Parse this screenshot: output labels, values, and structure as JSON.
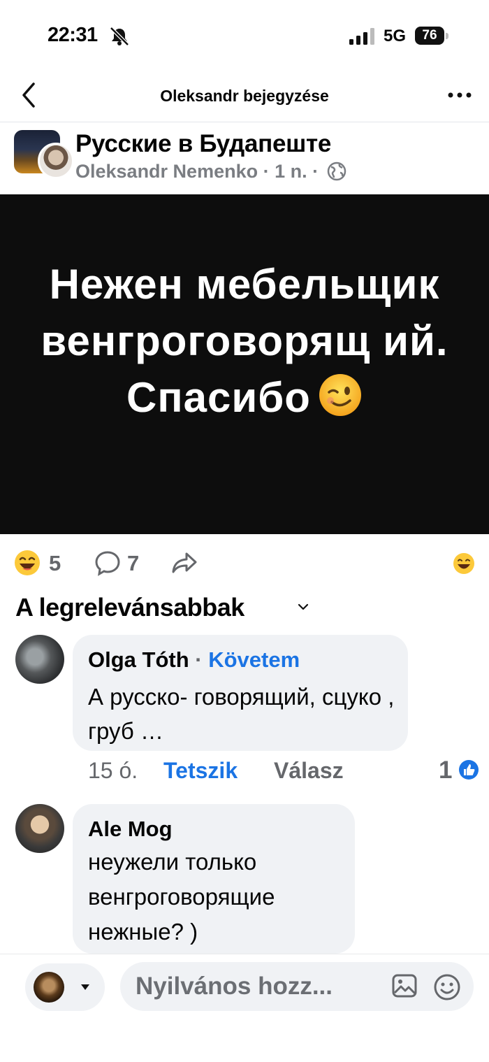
{
  "status_bar": {
    "time": "22:31",
    "network": "5G",
    "battery": "76"
  },
  "nav": {
    "title": "Oleksandr bejegyzése"
  },
  "post": {
    "group_name": "Русские в Будапеште",
    "author": "Oleksandr Nemenko",
    "separator": "·",
    "time": "1 n.",
    "image_text": "Нежен мебельщик венгроговорящ ий. Спасибо",
    "reaction_count": "5",
    "comment_count": "7"
  },
  "sort": {
    "label": "A legrelevánsabbak"
  },
  "comments": [
    {
      "author": "Olga Tóth",
      "dot": "·",
      "follow": "Követem",
      "text": "А русско- говорящий, сцуко , груб …",
      "time": "15 ó.",
      "like": "Tetszik",
      "reply": "Válasz",
      "likes": "1"
    },
    {
      "author": "Ale Mog",
      "text": "неужели только венгроговорящие нежные? )"
    }
  ],
  "composer": {
    "placeholder": "Nyilvános hozz..."
  },
  "colors": {
    "accent": "#1b74e4",
    "image_bg": "#0d0d0d",
    "bubble": "#f0f2f5"
  }
}
